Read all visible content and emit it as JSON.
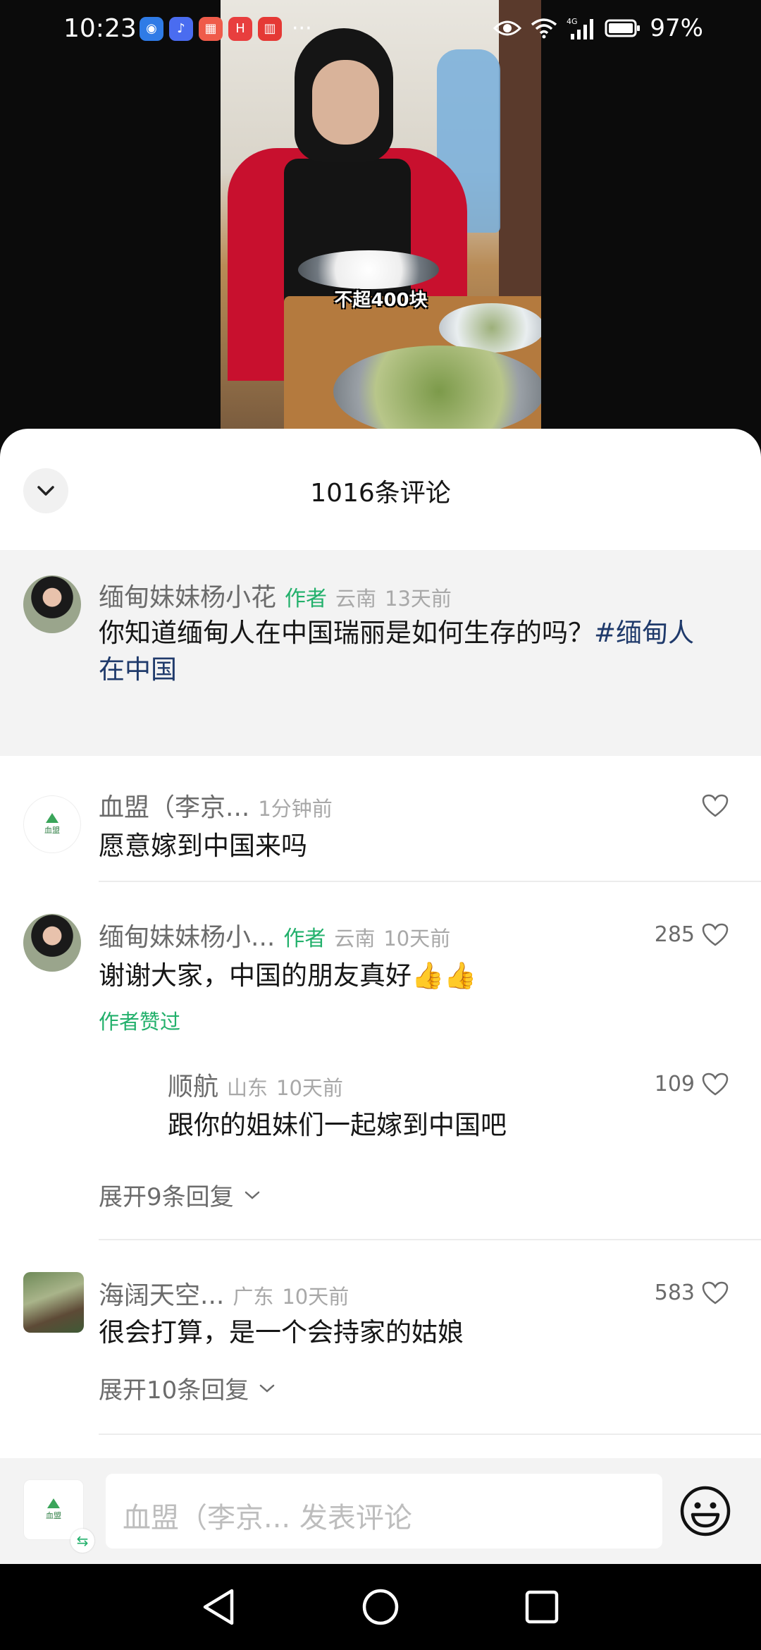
{
  "status_bar": {
    "time": "10:23",
    "apps": [
      {
        "icon": "browser-icon",
        "color": "#2f7be6",
        "glyph": "◉"
      },
      {
        "icon": "music-icon",
        "color": "#4a6cf0",
        "glyph": "♪"
      },
      {
        "icon": "store-icon",
        "color": "#ef5b4a",
        "glyph": "▦"
      },
      {
        "icon": "huawei-icon",
        "color": "#e83e3e",
        "glyph": "H"
      },
      {
        "icon": "reader-icon",
        "color": "#e53935",
        "glyph": "▥"
      }
    ],
    "more": "···",
    "battery_percent": "97%",
    "network": "4G"
  },
  "video": {
    "caption": "不超400块"
  },
  "sheet": {
    "title": "1016条评论",
    "pinned": {
      "username": "缅甸妹妹杨小花",
      "author_tag": "作者",
      "location": "云南",
      "time": "13天前",
      "text": "你知道缅甸人在中国瑞丽是如何生存的吗？",
      "hashtag_line1": "#缅甸人",
      "hashtag_line2": "在中国"
    },
    "comments": [
      {
        "username": "血盟（李京...",
        "time": "1分钟前",
        "text": "愿意嫁到中国来吗"
      },
      {
        "username": "缅甸妹妹杨小...",
        "author_tag": "作者",
        "location": "云南",
        "time": "10天前",
        "likes": "285",
        "text": "谢谢大家，中国的朋友真好👍👍",
        "author_liked": "作者赞过",
        "reply": {
          "username": "顺航",
          "location": "山东",
          "time": "10天前",
          "likes": "109",
          "text": "跟你的姐妹们一起嫁到中国吧"
        },
        "expand": "展开9条回复"
      },
      {
        "username": "海阔天空...",
        "location": "广东",
        "time": "10天前",
        "likes": "583",
        "text": "很会打算，是一个会持家的姑娘",
        "expand": "展开10条回复"
      }
    ],
    "logo_text": "血盟"
  },
  "input": {
    "placeholder": "血盟（李京... 发表评论"
  }
}
